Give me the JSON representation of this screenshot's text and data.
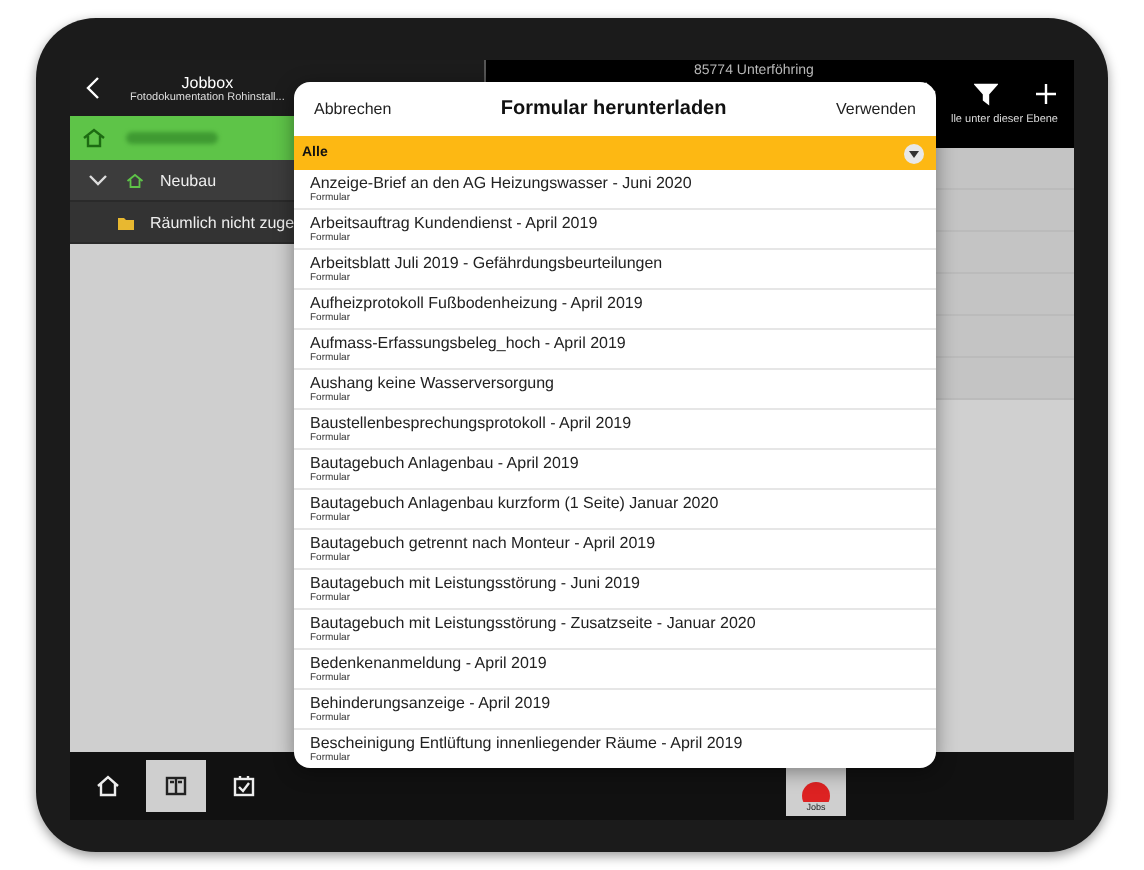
{
  "left_panel": {
    "title": "Jobbox",
    "subtitle": "Fotodokumentation Rohinstall...",
    "tree": [
      {
        "label": "Neubau",
        "expanded": true,
        "children": [
          {
            "label": "Räumlich nicht zuge"
          }
        ]
      }
    ]
  },
  "right_panel": {
    "location": "85774 Unterföhring",
    "hint": "lle unter dieser Ebene"
  },
  "modal": {
    "cancel": "Abbrechen",
    "title": "Formular herunterladen",
    "confirm": "Verwenden",
    "filter": "Alle",
    "items": [
      {
        "title": "Anzeige-Brief an den AG Heizungswasser - Juni 2020",
        "type": "Formular"
      },
      {
        "title": "Arbeitsauftrag Kundendienst - April 2019",
        "type": "Formular"
      },
      {
        "title": "Arbeitsblatt Juli 2019 - Gefährdungsbeurteilungen",
        "type": "Formular"
      },
      {
        "title": "Aufheizprotokoll Fußbodenheizung - April 2019",
        "type": "Formular"
      },
      {
        "title": "Aufmass-Erfassungsbeleg_hoch - April 2019",
        "type": "Formular"
      },
      {
        "title": "Aushang keine Wasserversorgung",
        "type": "Formular"
      },
      {
        "title": "Baustellenbesprechungsprotokoll - April 2019",
        "type": "Formular"
      },
      {
        "title": "Bautagebuch Anlagenbau - April 2019",
        "type": "Formular"
      },
      {
        "title": "Bautagebuch Anlagenbau kurzform (1 Seite) Januar 2020",
        "type": "Formular"
      },
      {
        "title": "Bautagebuch getrennt nach Monteur - April 2019",
        "type": "Formular"
      },
      {
        "title": "Bautagebuch mit Leistungsstörung - Juni 2019",
        "type": "Formular"
      },
      {
        "title": "Bautagebuch mit Leistungsstörung - Zusatzseite - Januar 2020",
        "type": "Formular"
      },
      {
        "title": "Bedenkenanmeldung - April 2019",
        "type": "Formular"
      },
      {
        "title": "Behinderungsanzeige - April 2019",
        "type": "Formular"
      },
      {
        "title": "Bescheinigung Entlüftung innenliegender Räume - April 2019",
        "type": "Formular"
      }
    ]
  },
  "tab_bar": {
    "tabs": [
      {
        "kind": "home",
        "selected": false
      },
      {
        "kind": "book",
        "selected": true
      },
      {
        "kind": "calendar",
        "selected": false
      }
    ],
    "jobs": "Jobs"
  }
}
